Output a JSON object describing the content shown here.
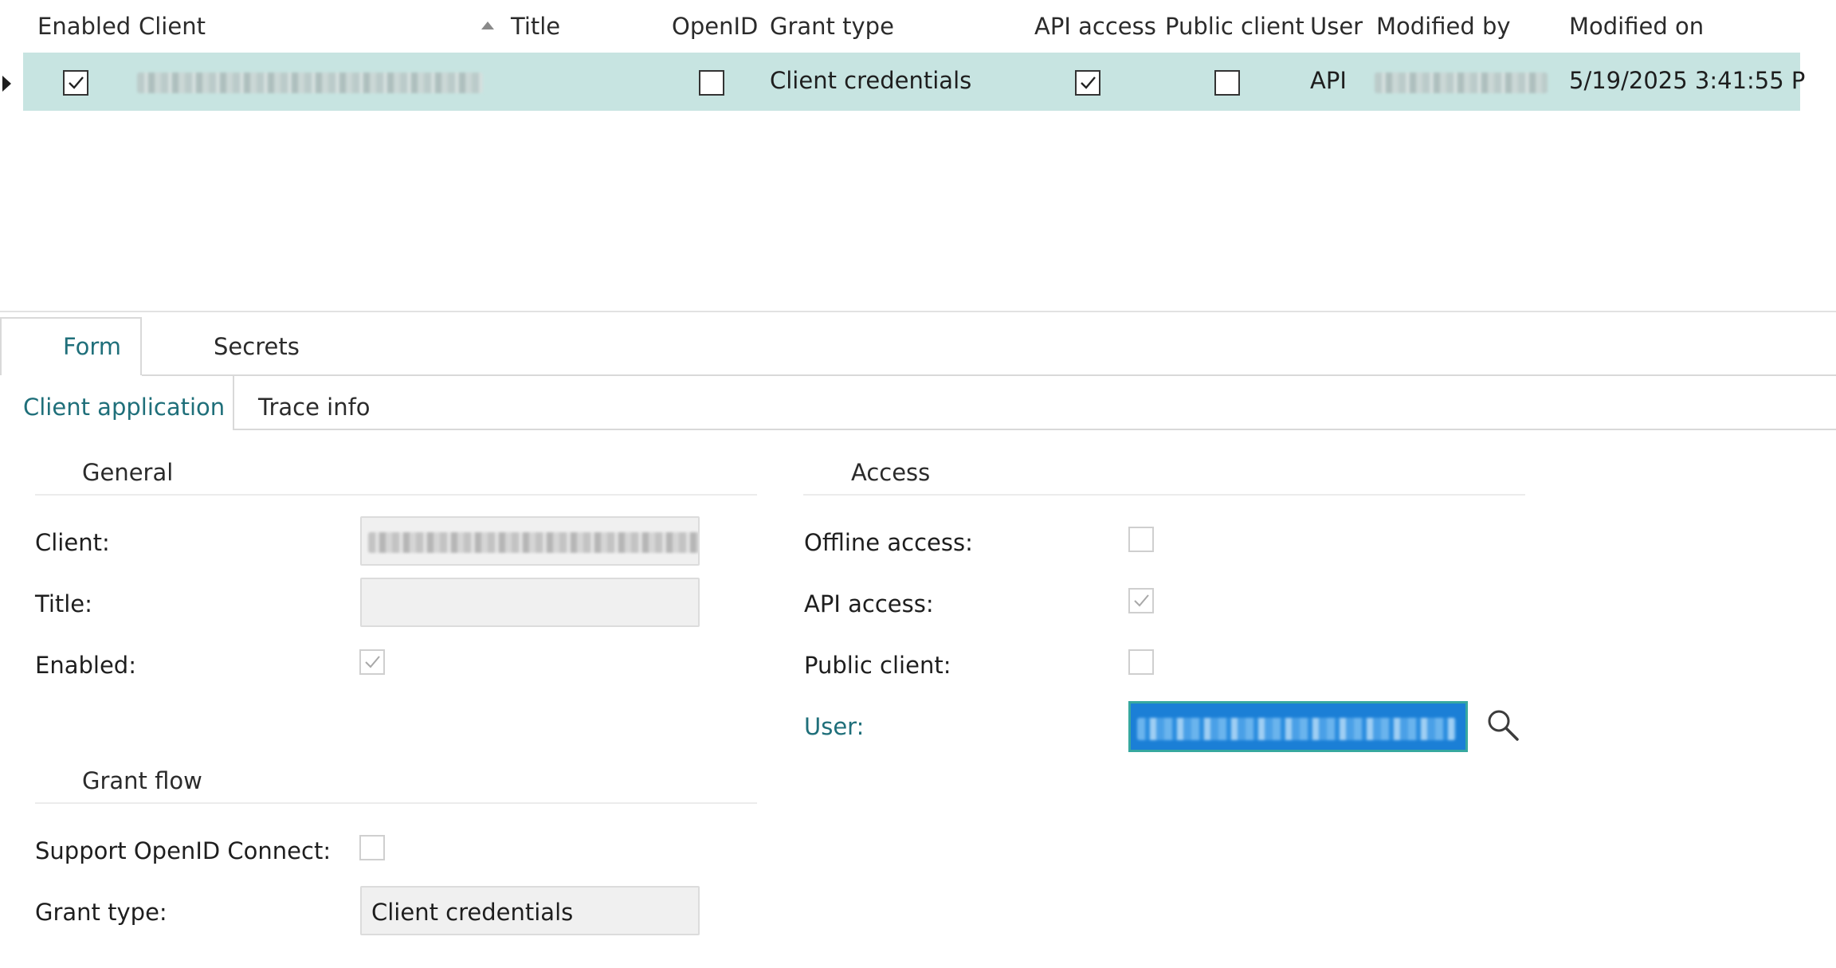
{
  "grid": {
    "columns": [
      "Enabled",
      "Client",
      "Title",
      "OpenID",
      "Grant type",
      "API access",
      "Public client",
      "User",
      "Modified by",
      "Modified on"
    ],
    "row": {
      "enabled": true,
      "client": "",
      "title": "",
      "openid": false,
      "grant_type": "Client credentials",
      "api_access": true,
      "public_client": false,
      "user": "API",
      "modified_by": "",
      "modified_on": "5/19/2025 3:41:55 P"
    }
  },
  "tabs": [
    "Form",
    "Secrets"
  ],
  "subtabs": [
    "Client application",
    "Trace info"
  ],
  "form": {
    "general": {
      "title": "General",
      "client_label": "Client:",
      "title_label": "Title:",
      "enabled_label": "Enabled:",
      "enabled": true
    },
    "access": {
      "title": "Access",
      "offline_label": "Offline access:",
      "offline": false,
      "api_label": "API access:",
      "api": true,
      "public_label": "Public client:",
      "public": false,
      "user_label": "User:"
    },
    "grant_flow": {
      "title": "Grant flow",
      "openid_label": "Support OpenID Connect:",
      "openid": false,
      "grant_type_label": "Grant type:",
      "grant_type_value": "Client credentials"
    }
  },
  "icons": {
    "lookup": "search-icon",
    "row_pointer": "triangle-right-icon"
  }
}
